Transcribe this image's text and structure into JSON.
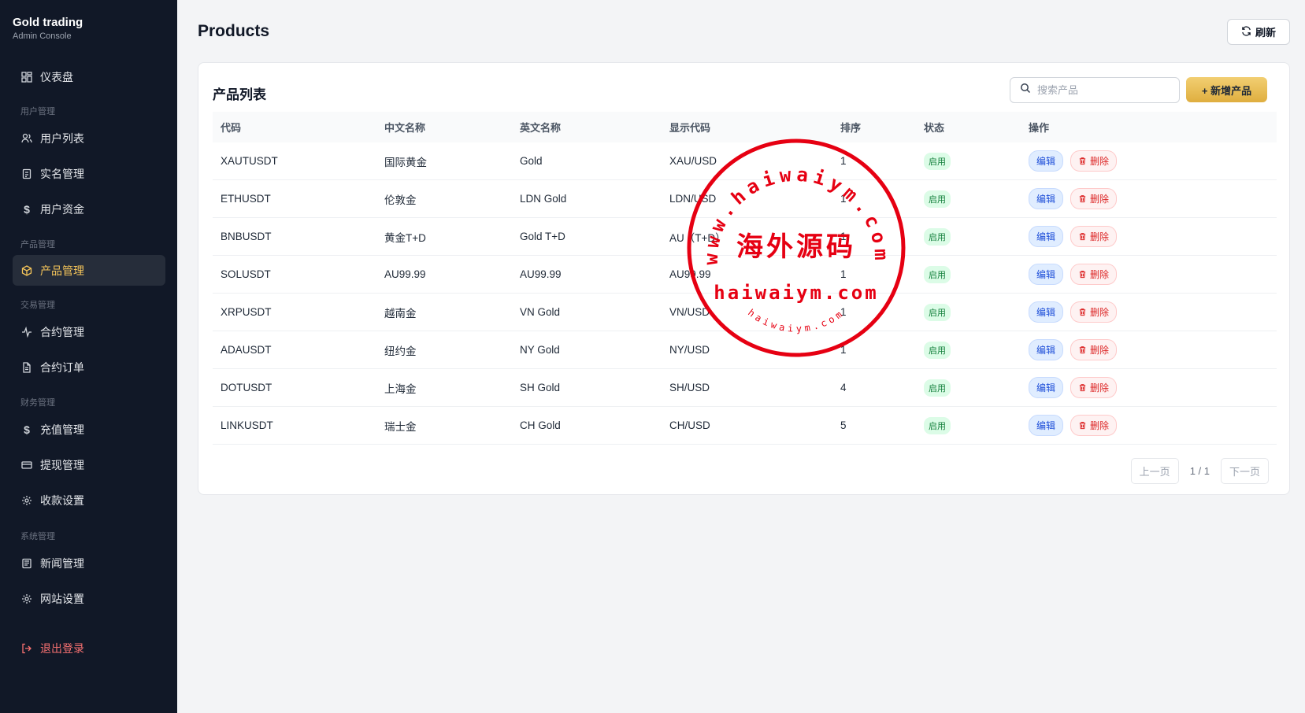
{
  "brand": {
    "title": "Gold trading",
    "subtitle": "Admin Console"
  },
  "nav": {
    "dashboard": "仪表盘",
    "sections": {
      "users": "用户管理",
      "products": "产品管理",
      "trading": "交易管理",
      "finance": "财务管理",
      "system": "系统管理"
    },
    "items": {
      "user_list": "用户列表",
      "kyc": "实名管理",
      "user_funds": "用户资金",
      "product_mgmt": "产品管理",
      "contract_mgmt": "合约管理",
      "contract_orders": "合约订单",
      "deposit_mgmt": "充值管理",
      "withdraw_mgmt": "提现管理",
      "payment_settings": "收款设置",
      "news_mgmt": "新闻管理",
      "site_settings": "网站设置",
      "logout": "退出登录"
    },
    "active": "product_mgmt"
  },
  "header": {
    "title": "Products",
    "refresh_label": "刷新"
  },
  "card": {
    "title": "产品列表",
    "search_placeholder": "搜索产品",
    "search_value": "",
    "add_label": "+ 新增产品"
  },
  "table": {
    "columns": [
      "代码",
      "中文名称",
      "英文名称",
      "显示代码",
      "排序",
      "状态",
      "操作"
    ],
    "rows": [
      {
        "code": "XAUTUSDT",
        "name_cn": "国际黄金",
        "name_en": "Gold",
        "display": "XAU/USD",
        "sort": "1",
        "status": "启用"
      },
      {
        "code": "ETHUSDT",
        "name_cn": "伦敦金",
        "name_en": "LDN Gold",
        "display": "LDN/USD",
        "sort": "1",
        "status": "启用"
      },
      {
        "code": "BNBUSDT",
        "name_cn": "黄金T+D",
        "name_en": "Gold T+D",
        "display": "AU（T+D）",
        "sort": "1",
        "status": "启用"
      },
      {
        "code": "SOLUSDT",
        "name_cn": "AU99.99",
        "name_en": "AU99.99",
        "display": "AU99.99",
        "sort": "1",
        "status": "启用"
      },
      {
        "code": "XRPUSDT",
        "name_cn": "越南金",
        "name_en": "VN Gold",
        "display": "VN/USD",
        "sort": "1",
        "status": "启用"
      },
      {
        "code": "ADAUSDT",
        "name_cn": "纽约金",
        "name_en": "NY Gold",
        "display": "NY/USD",
        "sort": "1",
        "status": "启用"
      },
      {
        "code": "DOTUSDT",
        "name_cn": "上海金",
        "name_en": "SH Gold",
        "display": "SH/USD",
        "sort": "4",
        "status": "启用"
      },
      {
        "code": "LINKUSDT",
        "name_cn": "瑞士金",
        "name_en": "CH Gold",
        "display": "CH/USD",
        "sort": "5",
        "status": "启用"
      }
    ],
    "edit_label": "编辑",
    "delete_label": "删除"
  },
  "pagination": {
    "prev": "上一页",
    "info": "1 / 1",
    "next": "下一页"
  },
  "watermark": {
    "url_top": "www.haiwaiym.com",
    "center_text": "海外源码",
    "url_mid": "haiwaiym.com",
    "url_bottom": "haiwaiym.com",
    "color": "#e60012"
  },
  "colors": {
    "sidebar_bg": "#111827",
    "active_accent": "#f5c55a",
    "primary_gold": "#e7bb52",
    "logout": "#f87171",
    "status_green": "#15803d"
  }
}
